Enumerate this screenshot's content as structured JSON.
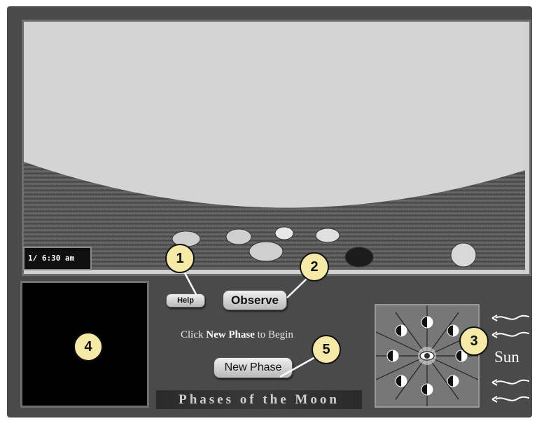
{
  "app": {
    "title": "Phases of the Moon"
  },
  "viewport": {
    "time": "1/ 6:30 am"
  },
  "controls": {
    "help_label": "Help",
    "observe_label": "Observe",
    "new_phase_label": "New Phase",
    "instruction_prefix": "Click ",
    "instruction_bold": "New Phase",
    "instruction_suffix": " to Begin"
  },
  "orbit": {
    "sun_label": "Sun",
    "observer_icon": "eye-icon",
    "moon_icon": "half-moon-icon"
  },
  "callouts": [
    "1",
    "2",
    "3",
    "4",
    "5"
  ],
  "colors": {
    "panel": "#4a4a4a",
    "callout": "#f7eaa8",
    "sky": "#d2d2d2"
  }
}
